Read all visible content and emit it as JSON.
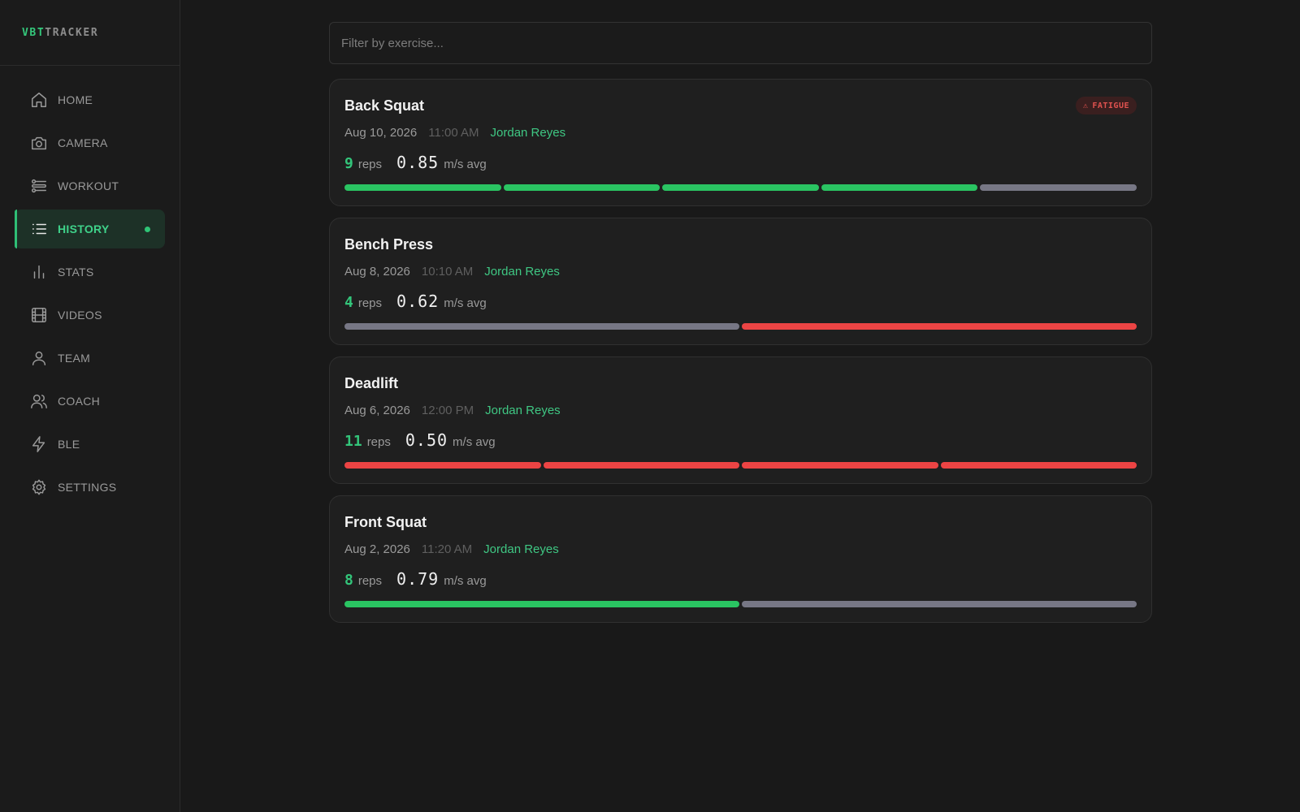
{
  "brand": {
    "accent": "VBT",
    "rest": "TRACKER"
  },
  "nav": [
    {
      "label": "HOME",
      "icon": "home-icon"
    },
    {
      "label": "CAMERA",
      "icon": "camera-icon"
    },
    {
      "label": "WORKOUT",
      "icon": "workout-icon"
    },
    {
      "label": "HISTORY",
      "icon": "list-icon",
      "active": true
    },
    {
      "label": "STATS",
      "icon": "bar-chart-icon"
    },
    {
      "label": "VIDEOS",
      "icon": "film-icon"
    },
    {
      "label": "TEAM",
      "icon": "user-icon"
    },
    {
      "label": "COACH",
      "icon": "users-icon"
    },
    {
      "label": "BLE",
      "icon": "lightning-icon"
    },
    {
      "label": "SETTINGS",
      "icon": "gear-icon"
    }
  ],
  "filter": {
    "placeholder": "Filter by exercise..."
  },
  "reps_label": "reps",
  "velocity_label": "m/s avg",
  "colors": {
    "good": "#2ac462",
    "neutral": "#777785",
    "slow": "#ec4444",
    "accent": "#34c77b"
  },
  "sessions": [
    {
      "exercise": "Back Squat",
      "date": "Aug 10, 2026",
      "time": "11:00 AM",
      "athlete": "Jordan Reyes",
      "reps": "9",
      "velocity": "0.85",
      "badge": "FATIGUE",
      "badge_icon": "⚠",
      "segments": [
        "good",
        "good",
        "good",
        "good",
        "neutral"
      ]
    },
    {
      "exercise": "Bench Press",
      "date": "Aug 8, 2026",
      "time": "10:10 AM",
      "athlete": "Jordan Reyes",
      "reps": "4",
      "velocity": "0.62",
      "segments": [
        "neutral",
        "slow"
      ]
    },
    {
      "exercise": "Deadlift",
      "date": "Aug 6, 2026",
      "time": "12:00 PM",
      "athlete": "Jordan Reyes",
      "reps": "11",
      "velocity": "0.50",
      "segments": [
        "slow",
        "slow",
        "slow",
        "slow"
      ]
    },
    {
      "exercise": "Front Squat",
      "date": "Aug 2, 2026",
      "time": "11:20 AM",
      "athlete": "Jordan Reyes",
      "reps": "8",
      "velocity": "0.79",
      "segments": [
        "good",
        "neutral"
      ]
    }
  ]
}
